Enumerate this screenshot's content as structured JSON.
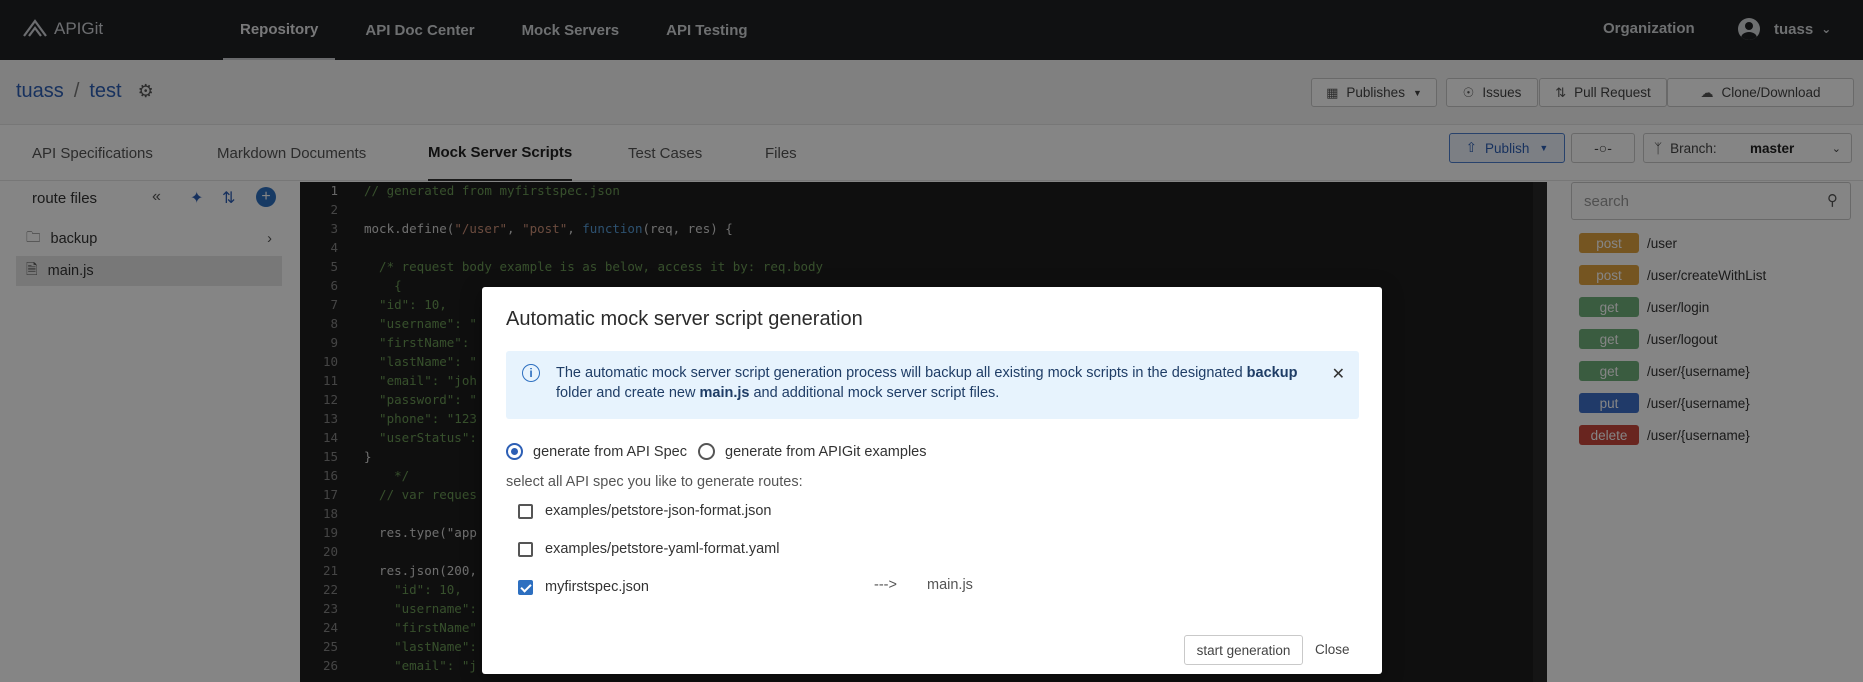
{
  "nav": {
    "logo_text": "APIGit",
    "links": [
      "Repository",
      "API Doc Center",
      "Mock Servers",
      "API Testing"
    ],
    "organization": "Organization",
    "username": "tuass"
  },
  "repo": {
    "owner": "tuass",
    "separator": "/",
    "name": "test",
    "buttons": {
      "publishes": "Publishes",
      "issues": "Issues",
      "pull_request": "Pull Request",
      "clone": "Clone/Download"
    }
  },
  "tabs": [
    "API Specifications",
    "Markdown Documents",
    "Mock Server Scripts",
    "Test Cases",
    "Files"
  ],
  "toolbar": {
    "publish": "Publish",
    "branch_label": "Branch:",
    "branch_value": "master"
  },
  "left_panel": {
    "title": "route files",
    "items": [
      {
        "label": "backup",
        "icon": "folder-icon"
      },
      {
        "label": "main.js",
        "icon": "file-icon"
      }
    ]
  },
  "editor": {
    "lines": [
      "// generated from myfirstspec.json",
      "",
      "mock.define(\"/user\", \"post\", function(req, res) {",
      "",
      "  /* request body example is as below, access it by: req.body",
      "    {",
      "  \"id\": 10,",
      "  \"username\": \"",
      "  \"firstName\":",
      "  \"lastName\": \"",
      "  \"email\": \"joh",
      "  \"password\": \"",
      "  \"phone\": \"123",
      "  \"userStatus\":",
      "}",
      "    */",
      "  // var reques",
      "",
      "  res.type(\"app",
      "",
      "  res.json(200,",
      "    \"id\": 10,",
      "    \"username\":",
      "    \"firstName\"",
      "    \"lastName\":",
      "    \"email\": \"j"
    ]
  },
  "right_panel": {
    "search_placeholder": "search",
    "routes": [
      {
        "method": "post",
        "path": "/user",
        "color": "#e0a340"
      },
      {
        "method": "post",
        "path": "/user/createWithList",
        "color": "#e0a340"
      },
      {
        "method": "get",
        "path": "/user/login",
        "color": "#6fb07c"
      },
      {
        "method": "get",
        "path": "/user/logout",
        "color": "#6fb07c"
      },
      {
        "method": "get",
        "path": "/user/{username}",
        "color": "#6fb07c"
      },
      {
        "method": "put",
        "path": "/user/{username}",
        "color": "#3f6fc9"
      },
      {
        "method": "delete",
        "path": "/user/{username}",
        "color": "#c9483c"
      }
    ]
  },
  "modal": {
    "title": "Automatic mock server script generation",
    "alert": {
      "part1": "The automatic mock server script generation process will backup all existing mock scripts in the designated ",
      "bold1": "backup",
      "part2": " folder and create new ",
      "bold2": "main.js",
      "part3": " and additional mock server script files."
    },
    "radio_options": [
      "generate from API Spec",
      "generate from APIGit examples"
    ],
    "subhead": "select all API spec you like to generate routes:",
    "specs": [
      {
        "label": "examples/petstore-json-format.json",
        "checked": false
      },
      {
        "label": "examples/petstore-yaml-format.yaml",
        "checked": false
      },
      {
        "label": "myfirstspec.json",
        "checked": true
      }
    ],
    "arrow": "--->",
    "target": "main.js",
    "start_button": "start generation",
    "close_button": "Close"
  }
}
